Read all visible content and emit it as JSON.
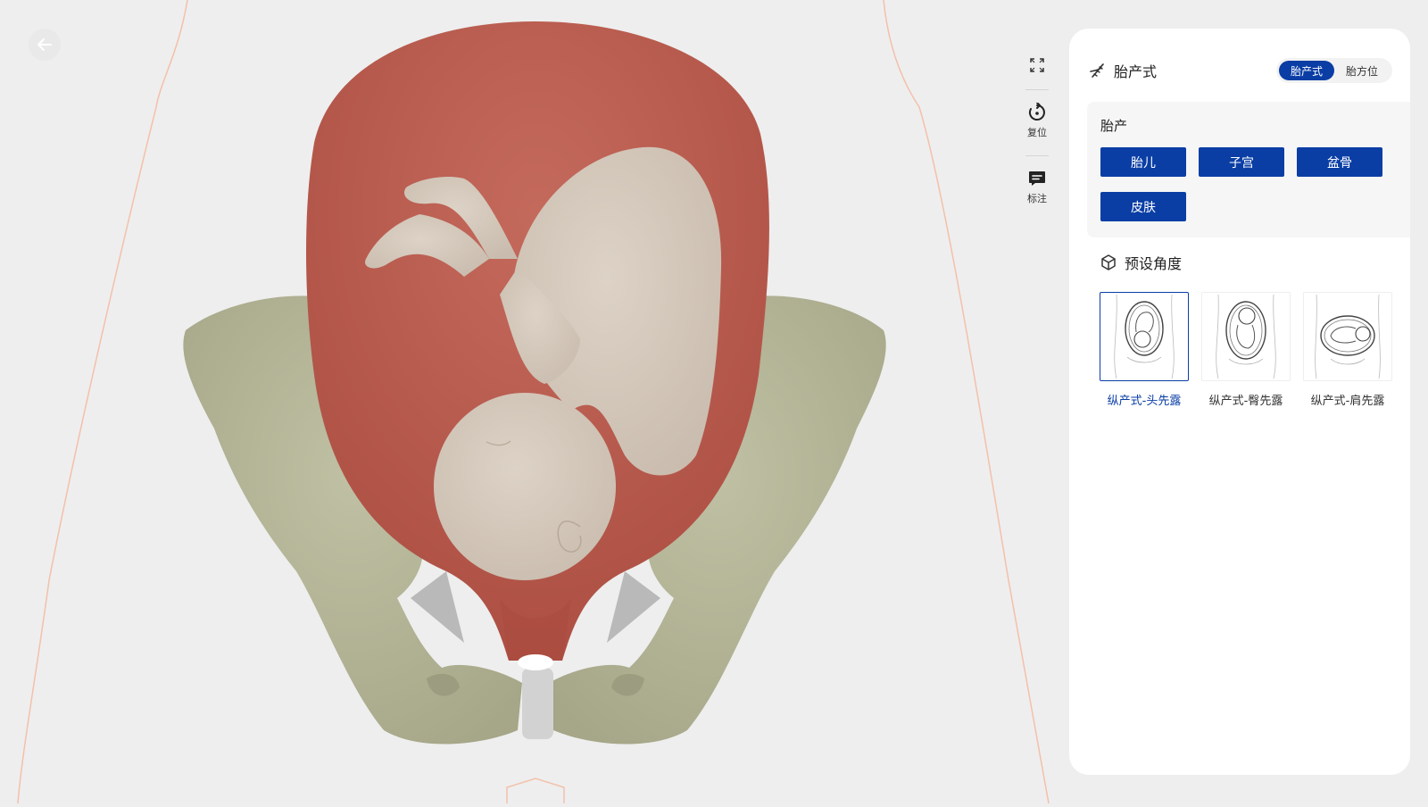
{
  "toolbar": {
    "reset_label": "复位",
    "annotate_label": "标注"
  },
  "panel": {
    "title": "胎产式",
    "segments": [
      {
        "label": "胎产式",
        "active": true
      },
      {
        "label": "胎方位",
        "active": false
      }
    ],
    "fetal_section": {
      "label": "胎产",
      "layers": [
        "胎儿",
        "子宫",
        "盆骨",
        "皮肤"
      ]
    },
    "presets": {
      "title": "预设角度",
      "items": [
        {
          "label": "纵产式-头先露",
          "selected": true
        },
        {
          "label": "纵产式-臀先露",
          "selected": false
        },
        {
          "label": "纵产式-肩先露",
          "selected": false
        }
      ]
    }
  },
  "colors": {
    "accent": "#0a3ea5",
    "background": "#eeeeee",
    "uterus": "#b9584b",
    "fetus": "#d6cabd",
    "pelvis": "#b1b193",
    "body_outline": "#f3c0aa"
  }
}
